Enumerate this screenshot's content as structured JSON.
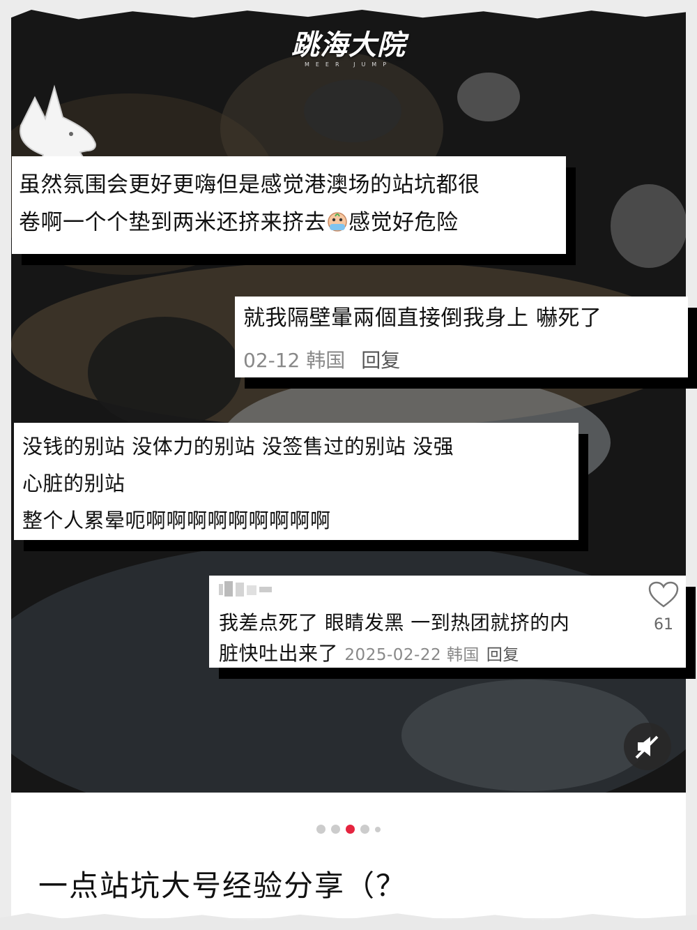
{
  "brand": {
    "title": "跳海大院",
    "subtitle": "MEER JUMP"
  },
  "comments": [
    {
      "id": "c1",
      "line1": "虽然氛围会更好更嗨但是感觉港澳场的站坑都很",
      "line2_before_emoji": "卷啊一个个垫到两米还挤来挤去",
      "emoji": "crying-face-emoji",
      "line2_after_emoji": "感觉好危险"
    },
    {
      "id": "c2",
      "text": "就我隔壁暈兩個直接倒我身上 嚇死了",
      "date": "02-12",
      "region": "韩国",
      "reply": "回复"
    },
    {
      "id": "c3",
      "line1": "没钱的别站 没体力的别站 没签售过的别站 没强",
      "line2": "心脏的别站",
      "line3": "整个人累晕呃啊啊啊啊啊啊啊啊啊"
    },
    {
      "id": "c4",
      "line1": "我差点死了 眼睛发黑 一到热团就挤的内",
      "line2": "脏快吐出来了",
      "date": "2025-02-22",
      "region": "韩国",
      "reply": "回复",
      "likes": "61"
    }
  ],
  "carousel": {
    "total": 5,
    "active_index": 2
  },
  "post": {
    "title": "一点站坑大号经验分享（？"
  },
  "colors": {
    "accent": "#e5243f",
    "card": "#ffffff",
    "shadow": "#000000"
  }
}
